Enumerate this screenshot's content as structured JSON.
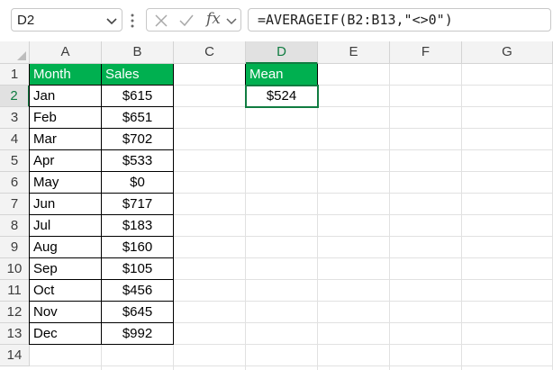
{
  "name_box": {
    "value": "D2"
  },
  "formula_bar": {
    "fx_label": "fx",
    "formula": "=AVERAGEIF(B2:B13,\"<>0\")"
  },
  "columns": [
    "A",
    "B",
    "C",
    "D",
    "E",
    "F",
    "G"
  ],
  "rows": [
    "1",
    "2",
    "3",
    "4",
    "5",
    "6",
    "7",
    "8",
    "9",
    "10",
    "11",
    "12",
    "13",
    "14"
  ],
  "selected": {
    "column": "D",
    "row": "2"
  },
  "table": {
    "headers": {
      "month": "Month",
      "sales": "Sales"
    },
    "rows": [
      {
        "month": "Jan",
        "sales": "$615"
      },
      {
        "month": "Feb",
        "sales": "$651"
      },
      {
        "month": "Mar",
        "sales": "$702"
      },
      {
        "month": "Apr",
        "sales": "$533"
      },
      {
        "month": "May",
        "sales": "$0"
      },
      {
        "month": "Jun",
        "sales": "$717"
      },
      {
        "month": "Jul",
        "sales": "$183"
      },
      {
        "month": "Aug",
        "sales": "$160"
      },
      {
        "month": "Sep",
        "sales": "$105"
      },
      {
        "month": "Oct",
        "sales": "$456"
      },
      {
        "month": "Nov",
        "sales": "$645"
      },
      {
        "month": "Dec",
        "sales": "$992"
      }
    ]
  },
  "mean": {
    "header": "Mean",
    "value": "$524"
  },
  "icons": {
    "name_box_dropdown": "chevron-down-icon",
    "more": "vertical-dots-icon",
    "cancel": "close-icon",
    "enter": "checkmark-icon",
    "fx_dropdown": "chevron-down-icon"
  },
  "colors": {
    "header_fill": "#00b050",
    "header_text": "#ffffff",
    "selection": "#107c41"
  }
}
